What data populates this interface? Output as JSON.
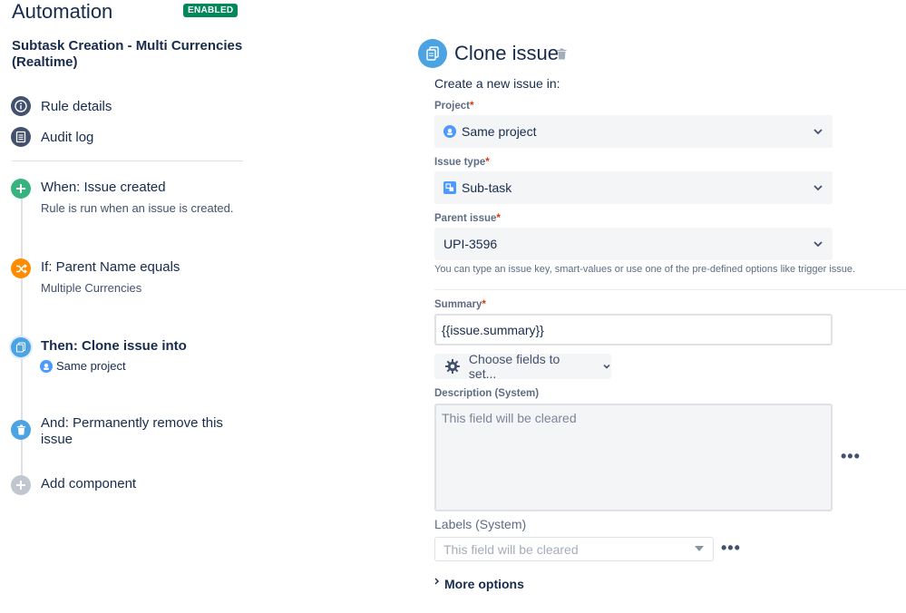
{
  "sidebar": {
    "app_title": "Automation",
    "status_badge": "ENABLED",
    "rule_name": "Subtask Creation - Multi Currencies (Realtime)",
    "nav": [
      {
        "label": "Rule details",
        "icon": "info-icon"
      },
      {
        "label": "Audit log",
        "icon": "list-icon"
      }
    ],
    "steps": [
      {
        "title": "When: Issue created",
        "subtitle": "Rule is run when an issue is created.",
        "icon": "plus-icon",
        "color": "#36b37e"
      },
      {
        "title": "If: Parent Name equals",
        "subtitle": "Multiple Currencies",
        "icon": "shuffle-icon",
        "color": "#ff8b00"
      },
      {
        "title": "Then: Clone issue into",
        "subtitle": "Same project",
        "icon": "clone-icon",
        "color": "#4ba3e3"
      },
      {
        "title": "And: Permanently remove this issue",
        "subtitle": "",
        "icon": "trash-icon",
        "color": "#4ba3e3"
      },
      {
        "title": "Add component",
        "subtitle": "",
        "icon": "plus-icon",
        "color": "#c1c7d0"
      }
    ]
  },
  "main": {
    "title": "Clone issue",
    "create_in_label": "Create a new issue in:",
    "project": {
      "label": "Project",
      "value": "Same project"
    },
    "issue_type": {
      "label": "Issue type",
      "value": "Sub-task"
    },
    "parent_issue": {
      "label": "Parent issue",
      "value": "UPI-3596",
      "help": "You can type an issue key, smart-values or use one of the pre-defined options like trigger issue."
    },
    "summary": {
      "label": "Summary",
      "value": "{{issue.summary}}"
    },
    "choose_fields_label": "Choose fields to set...",
    "description": {
      "label": "Description (System)",
      "placeholder": "This field will be cleared"
    },
    "labels": {
      "label": "Labels (System)",
      "placeholder": "This field will be cleared"
    },
    "more_options_label": "More options",
    "required_mark": "*",
    "more_actions_symbol": "•••"
  },
  "colors": {
    "accent": "#4ba3e3",
    "enabled": "#00875a",
    "required": "#de350b"
  }
}
